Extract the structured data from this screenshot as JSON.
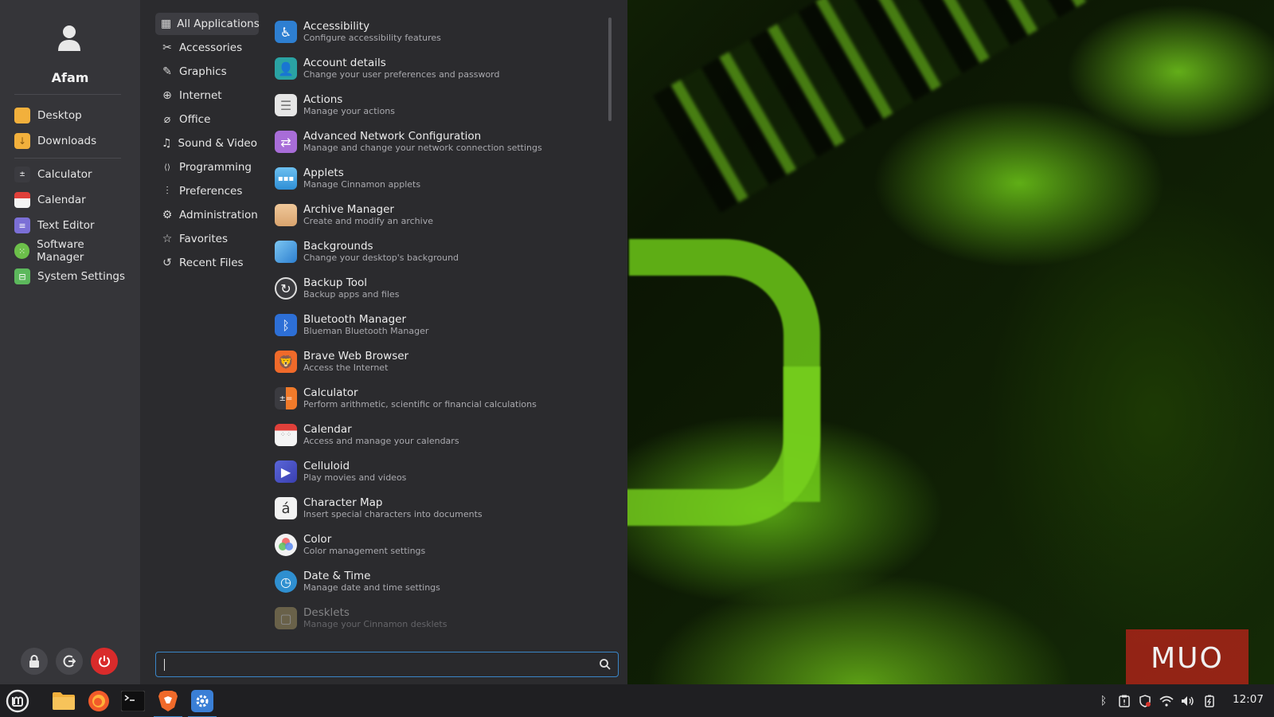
{
  "user": {
    "name": "Afam"
  },
  "places": [
    {
      "label": "Desktop",
      "icon": "folder-icon",
      "color": "#f2b03c"
    },
    {
      "label": "Downloads",
      "icon": "download-folder-icon",
      "color": "#f2b03c"
    }
  ],
  "favorites": [
    {
      "label": "Calculator",
      "icon": "calculator-icon",
      "color": "#3b3b40"
    },
    {
      "label": "Calendar",
      "icon": "calendar-icon",
      "color": "#e0403a"
    },
    {
      "label": "Text Editor",
      "icon": "text-editor-icon",
      "color": "#7b6fd6"
    },
    {
      "label": "Software Manager",
      "icon": "software-manager-icon",
      "color": "#6cbf4a"
    },
    {
      "label": "System Settings",
      "icon": "settings-toggle-icon",
      "color": "#5cb85c"
    }
  ],
  "session_buttons": [
    {
      "label": "lock",
      "icon": "lock-icon"
    },
    {
      "label": "logout",
      "icon": "logout-icon"
    },
    {
      "label": "power",
      "icon": "power-icon",
      "color": "#d92b2b"
    }
  ],
  "categories": [
    {
      "label": "All Applications",
      "icon": "grid-icon",
      "active": true
    },
    {
      "label": "Accessories",
      "icon": "tools-icon"
    },
    {
      "label": "Graphics",
      "icon": "palette-icon"
    },
    {
      "label": "Internet",
      "icon": "globe-icon"
    },
    {
      "label": "Office",
      "icon": "paperclip-icon"
    },
    {
      "label": "Sound & Video",
      "icon": "music-video-icon"
    },
    {
      "label": "Programming",
      "icon": "code-icon"
    },
    {
      "label": "Preferences",
      "icon": "sliders-icon"
    },
    {
      "label": "Administration",
      "icon": "gear-icon"
    },
    {
      "label": "Favorites",
      "icon": "star-icon"
    },
    {
      "label": "Recent Files",
      "icon": "history-icon"
    }
  ],
  "apps": [
    {
      "name": "Accessibility",
      "desc": "Configure accessibility features",
      "icon": "accessibility-icon",
      "color": "#2e7fd1"
    },
    {
      "name": "Account details",
      "desc": "Change your user preferences and password",
      "icon": "account-icon",
      "color": "#2aa3a3"
    },
    {
      "name": "Actions",
      "desc": "Manage your actions",
      "icon": "list-icon",
      "color": "#e6e6e6"
    },
    {
      "name": "Advanced Network Configuration",
      "desc": "Manage and change your network connection settings",
      "icon": "network-icon",
      "color": "#a86dd8"
    },
    {
      "name": "Applets",
      "desc": "Manage Cinnamon applets",
      "icon": "applets-icon",
      "color": "#4aa8e6"
    },
    {
      "name": "Archive Manager",
      "desc": "Create and modify an archive",
      "icon": "archive-icon",
      "color": "#e2b88a"
    },
    {
      "name": "Backgrounds",
      "desc": "Change your desktop's background",
      "icon": "backgrounds-icon",
      "color": "#3f9be6"
    },
    {
      "name": "Backup Tool",
      "desc": "Backup apps and files",
      "icon": "backup-icon",
      "color": "#3b3b3f"
    },
    {
      "name": "Bluetooth Manager",
      "desc": "Blueman Bluetooth Manager",
      "icon": "bluetooth-icon",
      "color": "#2d6fd6"
    },
    {
      "name": "Brave Web Browser",
      "desc": "Access the Internet",
      "icon": "brave-icon",
      "color": "#f06a2a"
    },
    {
      "name": "Calculator",
      "desc": "Perform arithmetic, scientific or financial calculations",
      "icon": "calculator-icon",
      "color": "#3b3b40"
    },
    {
      "name": "Calendar",
      "desc": "Access and manage your calendars",
      "icon": "calendar-icon",
      "color": "#f0f0f0"
    },
    {
      "name": "Celluloid",
      "desc": "Play movies and videos",
      "icon": "play-icon",
      "color": "#4a56c8"
    },
    {
      "name": "Character Map",
      "desc": "Insert special characters into documents",
      "icon": "character-map-icon",
      "color": "#f2f2f2"
    },
    {
      "name": "Color",
      "desc": "Color management settings",
      "icon": "color-wheel-icon",
      "color": "#f2f2f2"
    },
    {
      "name": "Date & Time",
      "desc": "Manage date and time settings",
      "icon": "clock-icon",
      "color": "#2f8fd0"
    },
    {
      "name": "Desklets",
      "desc": "Manage your Cinnamon desklets",
      "icon": "desklets-icon",
      "color": "#b5a46a",
      "faded": true
    }
  ],
  "search": {
    "placeholder": "",
    "value": ""
  },
  "taskbar": {
    "apps": [
      {
        "name": "menu",
        "icon": "mint-logo-icon"
      },
      {
        "name": "files",
        "icon": "folder-icon"
      },
      {
        "name": "firefox",
        "icon": "firefox-icon"
      },
      {
        "name": "terminal",
        "icon": "terminal-icon"
      },
      {
        "name": "brave",
        "icon": "brave-icon",
        "running": true
      },
      {
        "name": "settings",
        "icon": "settings-icon",
        "running": true
      }
    ],
    "tray": [
      "bluetooth-icon",
      "clipboard-icon",
      "shield-icon",
      "wifi-icon",
      "volume-icon",
      "battery-icon"
    ],
    "clock": "12:07"
  },
  "watermark": "MUO"
}
